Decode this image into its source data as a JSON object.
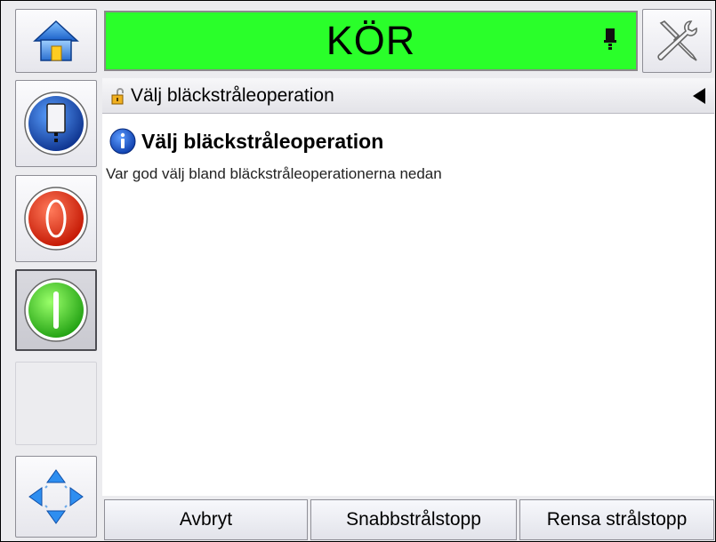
{
  "status": {
    "label": "KÖR",
    "color": "#2aff2a"
  },
  "icons": {
    "home": "home-icon",
    "tools": "tools-icon",
    "ink": "ink-bottle-icon",
    "stop": "stop-icon",
    "start": "start-icon",
    "nav": "navigation-arrows-icon",
    "lock": "lock-icon",
    "info": "info-icon",
    "back": "back-arrow-icon",
    "status_indicator": "printhead-icon"
  },
  "breadcrumb": {
    "title": "Välj bläckstråleoperation"
  },
  "content": {
    "heading": "Välj bläckstråleoperation",
    "description": "Var god välj bland bläckstråleoperationerna nedan"
  },
  "buttons": {
    "cancel": "Avbryt",
    "quick_stop": "Snabbstrålstopp",
    "clean_stop": "Rensa strålstopp"
  }
}
